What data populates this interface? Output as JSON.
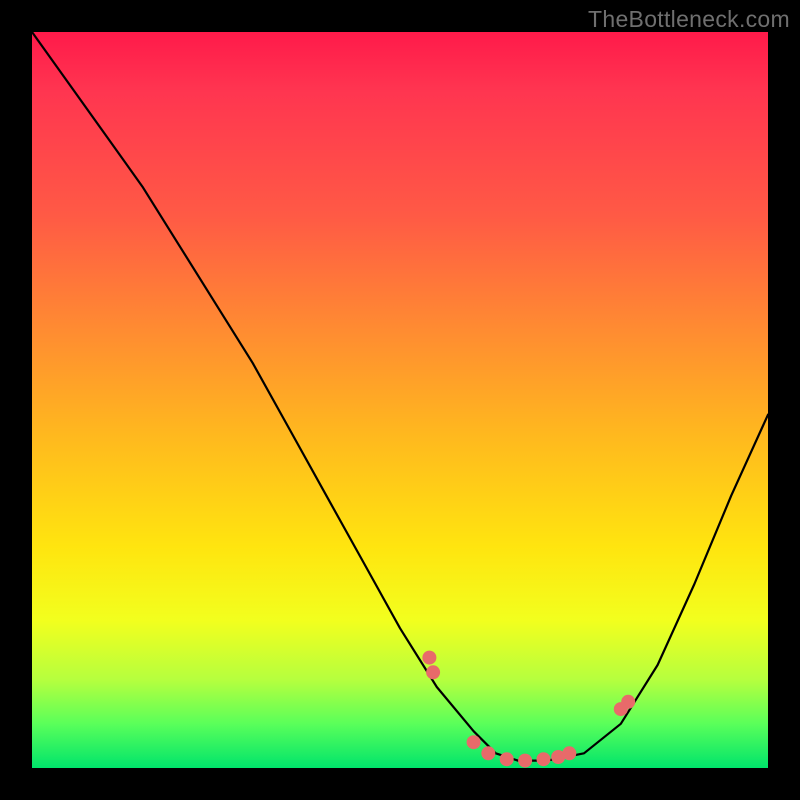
{
  "watermark": "TheBottleneck.com",
  "colors": {
    "frame": "#000000",
    "gradient_top": "#ff1a4a",
    "gradient_mid": "#ffe50f",
    "gradient_bottom": "#00e46b",
    "curve": "#000000",
    "marker": "#e86a6a"
  },
  "chart_data": {
    "type": "line",
    "title": "",
    "xlabel": "",
    "ylabel": "",
    "xlim": [
      0,
      100
    ],
    "ylim": [
      0,
      100
    ],
    "grid": false,
    "series": [
      {
        "name": "bottleneck-curve",
        "x": [
          0,
          5,
          10,
          15,
          20,
          25,
          30,
          35,
          40,
          45,
          50,
          55,
          60,
          63,
          66,
          70,
          75,
          80,
          85,
          90,
          95,
          100
        ],
        "values": [
          100,
          93,
          86,
          79,
          71,
          63,
          55,
          46,
          37,
          28,
          19,
          11,
          5,
          2,
          1,
          1,
          2,
          6,
          14,
          25,
          37,
          48
        ]
      }
    ],
    "markers": {
      "name": "highlighted-points",
      "x": [
        54,
        54.5,
        60,
        62,
        64.5,
        67,
        69.5,
        71.5,
        73,
        80,
        81
      ],
      "values": [
        15,
        13,
        3.5,
        2,
        1.2,
        1,
        1.2,
        1.5,
        2,
        8,
        9
      ]
    }
  }
}
